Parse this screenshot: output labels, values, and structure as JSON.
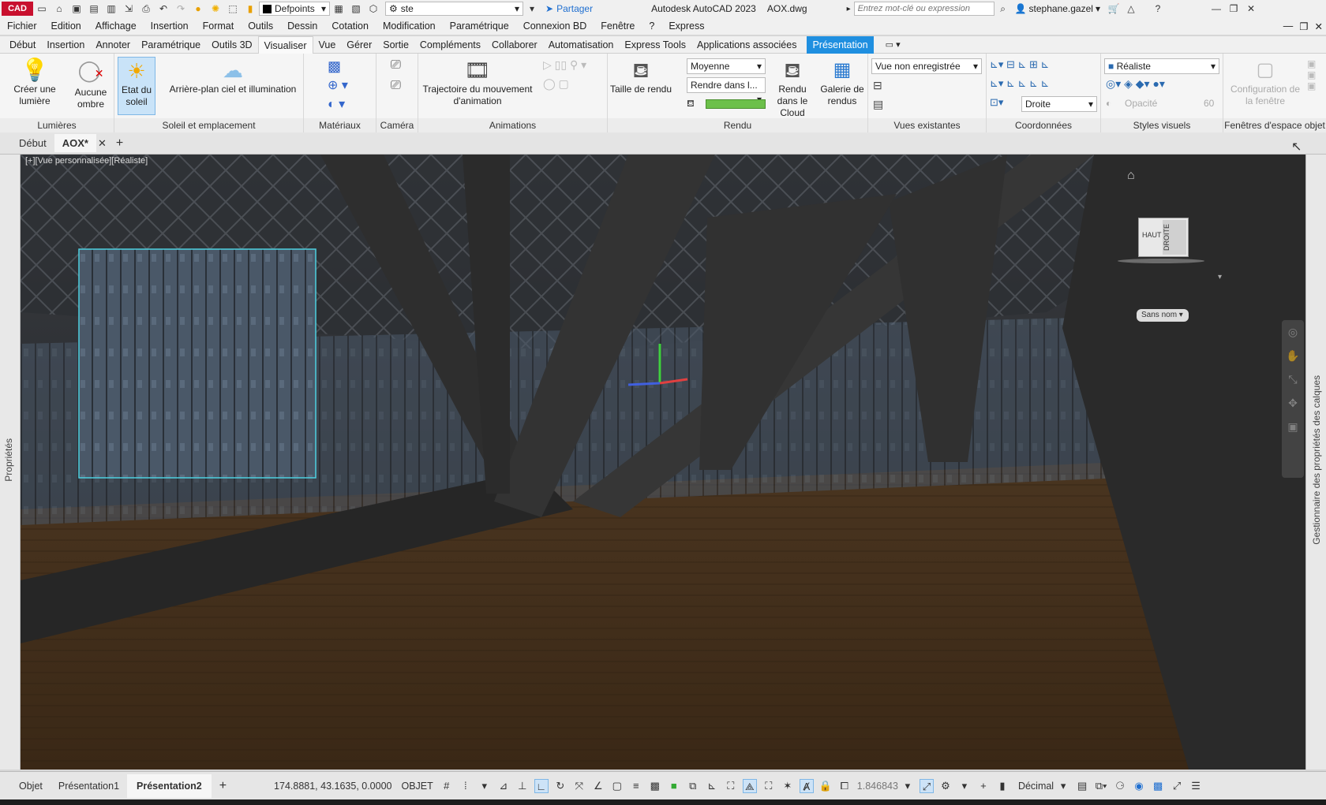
{
  "titlebar": {
    "logo": "CAD",
    "workspace": "Defpoints",
    "layer": "ste",
    "share": "Partager",
    "app_title": "Autodesk AutoCAD 2023",
    "filename": "AOX.dwg",
    "search_placeholder": "Entrez mot-clé ou expression",
    "user": "stephane.gazel"
  },
  "menu": [
    "Fichier",
    "Edition",
    "Affichage",
    "Insertion",
    "Format",
    "Outils",
    "Dessin",
    "Cotation",
    "Modification",
    "Paramétrique",
    "Connexion BD",
    "Fenêtre",
    "?",
    "Express"
  ],
  "ribbon_tabs": [
    "Début",
    "Insertion",
    "Annoter",
    "Paramétrique",
    "Outils 3D",
    "Visualiser",
    "Vue",
    "Gérer",
    "Sortie",
    "Compléments",
    "Collaborer",
    "Automatisation",
    "Express Tools",
    "Applications associées",
    "Présentation"
  ],
  "ribbon": {
    "lights": {
      "create_light": "Créer une lumière",
      "no_shadow": "Aucune ombre",
      "sun_state": "Etat du soleil",
      "title": "Lumières"
    },
    "sun": {
      "sky": "Arrière-plan ciel et illumination",
      "title": "Soleil et emplacement"
    },
    "materials": {
      "title": "Matériaux"
    },
    "camera": {
      "title": "Caméra"
    },
    "animations": {
      "motion_path": "Trajectoire du mouvement d'animation",
      "title": "Animations"
    },
    "render": {
      "size": "Taille de rendu",
      "quality": "Moyenne",
      "render_in": "Rendre dans l...",
      "cloud": "Rendu dans le Cloud",
      "gallery": "Galerie de rendus",
      "title": "Rendu"
    },
    "views": {
      "unsaved": "Vue non enregistrée",
      "title": "Vues existantes"
    },
    "coords": {
      "right": "Droite",
      "title": "Coordonnées"
    },
    "visual": {
      "style": "Réaliste",
      "opacity": "Opacité",
      "opacity_val": "60",
      "title": "Styles visuels"
    },
    "viewports": {
      "config": "Configuration de la fenêtre",
      "title": "Fenêtres d'espace objet"
    }
  },
  "doc_tabs": {
    "start": "Début",
    "current": "AOX*"
  },
  "viewport": {
    "label": "[+][Vue personnalisée][Réaliste]",
    "viewcube_top": "HAUT",
    "viewcube_right": "DROITE",
    "ucs_name": "Sans nom"
  },
  "side": {
    "left": "Propriétés",
    "right": "Gestionnaire des propriétés des calques"
  },
  "status": {
    "tabs": [
      "Objet",
      "Présentation1",
      "Présentation2"
    ],
    "coords": "174.8881, 43.1635, 0.0000",
    "mode": "OBJET",
    "scale": "1.846843",
    "units": "Décimal"
  }
}
